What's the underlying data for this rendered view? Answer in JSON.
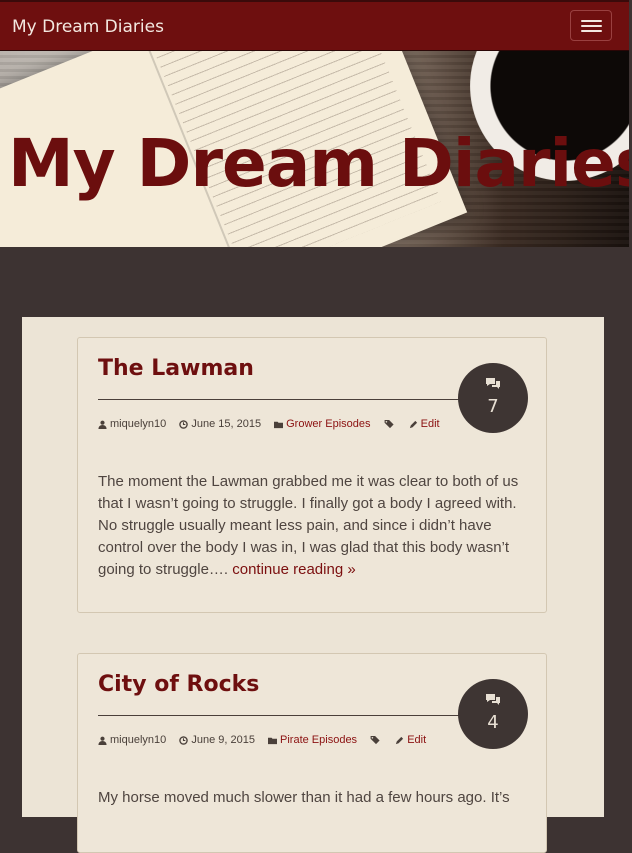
{
  "nav": {
    "brand": "My Dream Diaries",
    "menu_icon": "hamburger-icon"
  },
  "hero": {
    "title": "My Dream Diaries"
  },
  "posts": [
    {
      "title": "The Lawman",
      "comments": "7",
      "author": "miquelyn10",
      "date": "June 15, 2015",
      "category": "Grower Episodes",
      "edit": "Edit",
      "excerpt": "The moment the Lawman grabbed me it was clear to both of us that I wasn’t going to struggle. I finally got a body I agreed with. No struggle usually meant less pain, and since i didn’t have control over the body I was in, I was glad that this body wasn’t going to struggle….",
      "more": "continue reading »"
    },
    {
      "title": "City of Rocks",
      "comments": "4",
      "author": "miquelyn10",
      "date": "June 9, 2015",
      "category": "Pirate Episodes",
      "edit": "Edit",
      "excerpt": "My horse moved much slower than it had a few hours ago. It’s",
      "more": ""
    }
  ],
  "colors": {
    "accent": "#6e0f0f",
    "page_bg": "#3d3332",
    "content_bg": "#ece4d6"
  }
}
